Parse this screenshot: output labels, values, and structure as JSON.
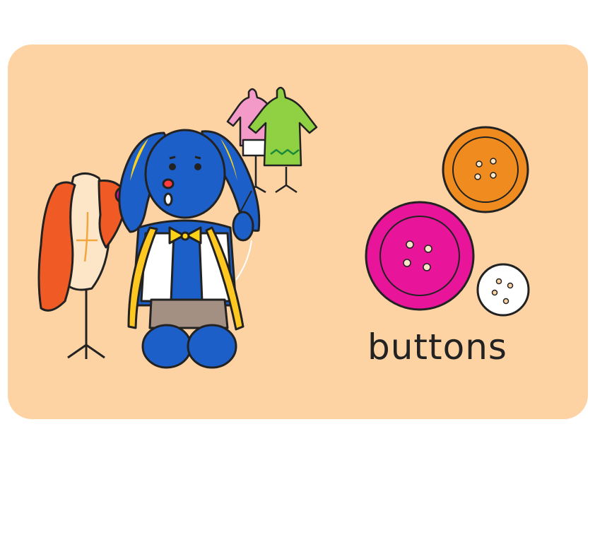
{
  "card": {
    "word": "buttons",
    "background_color": "#fdd3a4"
  },
  "illustration": {
    "character": "blue-bunny-tailor-with-tape-measure",
    "props": [
      "dress-form-with-orange-fabric",
      "clothes-rack-with-pink-and-green-garments"
    ]
  },
  "buttons": [
    {
      "color": "#f08b1f",
      "holes": 4
    },
    {
      "color": "#e8149a",
      "holes": 4
    },
    {
      "color": "#ffffff",
      "holes": 4
    }
  ]
}
